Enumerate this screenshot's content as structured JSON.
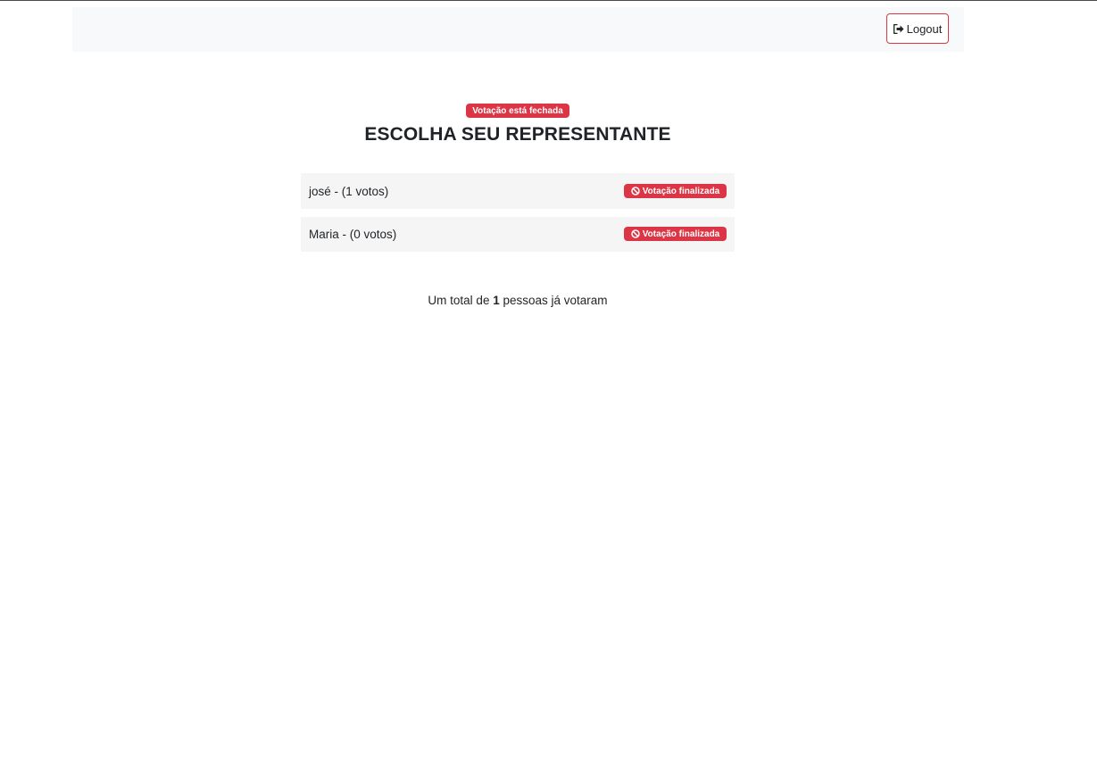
{
  "navbar": {
    "logout_label": "Logout",
    "logout_icon": "sign-out-icon"
  },
  "poll": {
    "status_badge": "Votação está fechada",
    "title": "ESCOLHA SEU REPRESENTANTE",
    "candidates": [
      {
        "label": "josé - (1 votos)",
        "badge": "Votação finalizada",
        "badge_icon": "ban-icon"
      },
      {
        "label": "Maria - (0 votos)",
        "badge": "Votação finalizada",
        "badge_icon": "ban-icon"
      }
    ],
    "total": {
      "prefix": "Um total de",
      "count": "1",
      "suffix": "pessoas já votaram"
    }
  },
  "colors": {
    "danger": "#dc3545",
    "navbar_bg": "#f8f9fa",
    "row_bg": "#f5f5f5"
  }
}
